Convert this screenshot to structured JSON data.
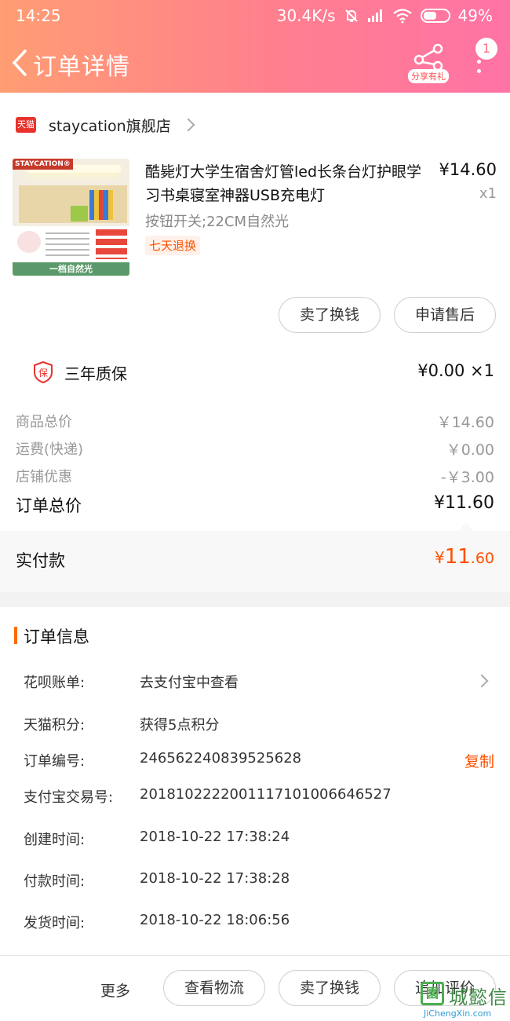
{
  "status_bar": {
    "time": "14:25",
    "network_speed": "30.4K/s",
    "battery": "49%"
  },
  "nav": {
    "back_icon": "chevron-left-icon",
    "title": "订单详情",
    "share_label": "分享有礼",
    "notification_count": "1"
  },
  "shop": {
    "badge": "天猫",
    "name": "staycation旗舰店"
  },
  "product": {
    "thumb_brand": "STAYCATION®",
    "thumb_caption": "一档自然光",
    "title": "酷毙灯大学生宿舍灯管led长条台灯护眼学习书桌寝室神器USB充电灯",
    "price": "¥14.60",
    "qty": "x1",
    "spec": "按钮开关;22CM自然光",
    "tag": "七天退换"
  },
  "item_actions": {
    "sell": "卖了换钱",
    "after_sale": "申请售后"
  },
  "warranty": {
    "icon_text": "保",
    "label": "三年质保",
    "value": "¥0.00 ×1"
  },
  "summary": {
    "goods_total_label": "商品总价",
    "goods_total": "￥14.60",
    "shipping_label": "运费(快递)",
    "shipping": "￥0.00",
    "discount_label": "店铺优惠",
    "discount": "-￥3.00",
    "order_total_label": "订单总价",
    "order_total": "¥11.60"
  },
  "paid": {
    "label": "实付款",
    "symbol": "¥",
    "integer": "11",
    "decimal": ".60"
  },
  "order_info": {
    "title": "订单信息",
    "huabei_label": "花呗账单:",
    "huabei_value": "去支付宝中查看",
    "points_label": "天猫积分:",
    "points_value": "获得5点积分",
    "order_no_label": "订单编号:",
    "order_no": "246562240839525628",
    "copy": "复制",
    "alipay_label": "支付宝交易号:",
    "alipay_no": "2018102222001117101006646527",
    "created_label": "创建时间:",
    "created": "2018-10-22 17:38:24",
    "paid_label": "付款时间:",
    "paid_time": "2018-10-22 17:38:28",
    "shipped_label": "发货时间:",
    "shipped": "2018-10-22 18:06:56"
  },
  "bottom_bar": {
    "more": "更多",
    "logistics": "查看物流",
    "sell": "卖了换钱",
    "review": "追加评价"
  },
  "watermark": {
    "cn": "城懿信",
    "url": "JiChengXin.com"
  },
  "colors": {
    "accent": "#ff5000",
    "header_start": "#ff9d73",
    "header_end": "#ff73a6"
  }
}
